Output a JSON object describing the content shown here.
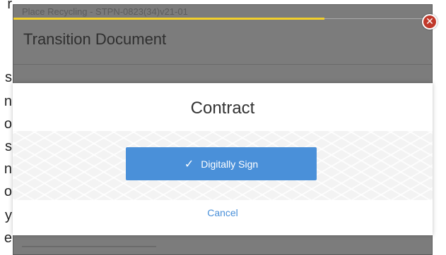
{
  "background": {
    "header_text": "Place Recycling - STPN-0823(34)v21-01",
    "title": "Transition Document"
  },
  "edge_letters": [
    "r",
    "s",
    "n",
    "o",
    "s",
    "n",
    "o",
    "y",
    "e"
  ],
  "modal": {
    "title": "Contract",
    "sign_button_label": "Digitally Sign",
    "cancel_label": "Cancel"
  },
  "icons": {
    "check": "check-icon",
    "close": "close-icon"
  },
  "colors": {
    "primary_button": "#4a90d9",
    "close_button": "#c0392b",
    "progress": "#f2cf2a"
  }
}
